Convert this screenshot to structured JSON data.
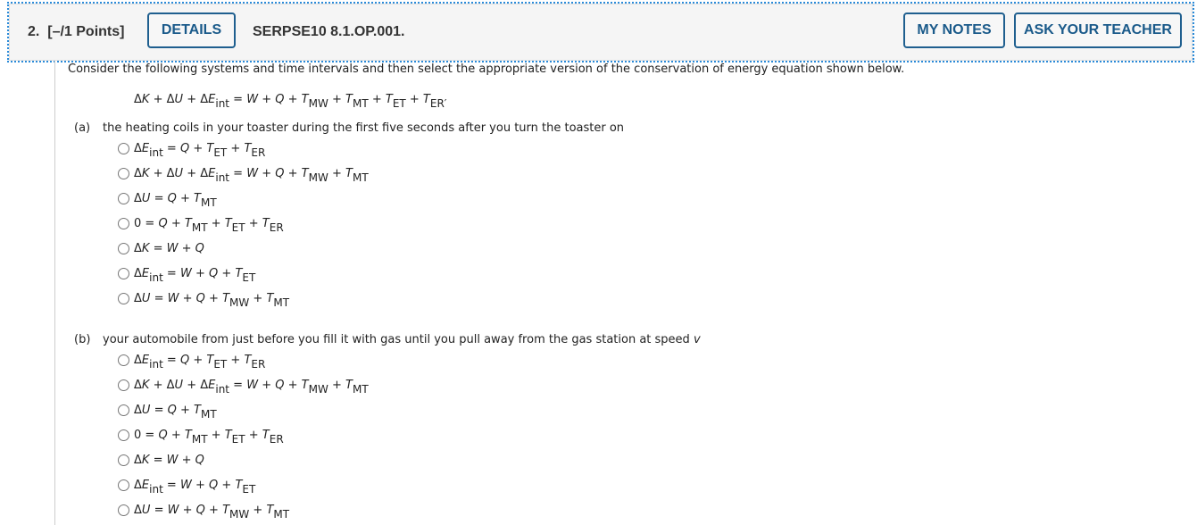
{
  "header": {
    "question_number": "2.",
    "points": "[–/1 Points]",
    "details_button": "DETAILS",
    "question_code": "SERPSE10 8.1.OP.001.",
    "my_notes_button": "MY NOTES",
    "ask_teacher_button": "ASK YOUR TEACHER"
  },
  "question": {
    "intro": "Consider the following systems and time intervals and then select the appropriate version of the conservation of energy equation shown below.",
    "main_equation": "ΔK + ΔU + ΔE_int = W + Q + T_MW + T_MT + T_ET + T_ER"
  },
  "parts": [
    {
      "tag": "(a)",
      "prompt": "the heating coils in your toaster during the first five seconds after you turn the toaster on",
      "options": [
        "ΔE_int = Q + T_ET + T_ER",
        "ΔK + ΔU + ΔE_int = W + Q + T_MW + T_MT",
        "ΔU = Q + T_MT",
        "0 = Q + T_MT + T_ET + T_ER",
        "ΔK = W + Q",
        "ΔE_int = W + Q + T_ET",
        "ΔU = W + Q + T_MW + T_MT"
      ]
    },
    {
      "tag": "(b)",
      "prompt": "your automobile from just before you fill it with gas until you pull away from the gas station at speed",
      "prompt_var": "v",
      "options": [
        "ΔE_int = Q + T_ET + T_ER",
        "ΔK + ΔU + ΔE_int = W + Q + T_MW + T_MT",
        "ΔU = Q + T_MT",
        "0 = Q + T_MT + T_ET + T_ER",
        "ΔK = W + Q",
        "ΔE_int = W + Q + T_ET",
        "ΔU = W + Q + T_MW + T_MT"
      ]
    }
  ]
}
